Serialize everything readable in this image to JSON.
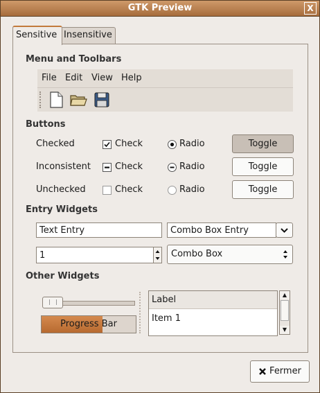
{
  "window": {
    "title": "GTK Preview",
    "close_symbol": "X"
  },
  "tabs": [
    {
      "label": "Sensitive"
    },
    {
      "label": "Insensitive"
    }
  ],
  "sections": {
    "menus": "Menu and Toolbars",
    "buttons": "Buttons",
    "entries": "Entry Widgets",
    "other": "Other Widgets"
  },
  "menu": [
    "File",
    "Edit",
    "View",
    "Help"
  ],
  "toolbar_icons": [
    "new-document-icon",
    "open-folder-icon",
    "save-floppy-icon"
  ],
  "buttons": {
    "rows": [
      {
        "label": "Checked",
        "check": "Check",
        "radio": "Radio",
        "toggle": "Toggle",
        "state": "checked"
      },
      {
        "label": "Inconsistent",
        "check": "Check",
        "radio": "Radio",
        "toggle": "Toggle",
        "state": "inconsistent"
      },
      {
        "label": "Unchecked",
        "check": "Check",
        "radio": "Radio",
        "toggle": "Toggle",
        "state": "unchecked"
      }
    ]
  },
  "entries": {
    "text_entry": "Text Entry",
    "combo_entry": "Combo Box Entry",
    "spin_value": "1",
    "combo_box": "Combo Box"
  },
  "other": {
    "slider_value": 0.0,
    "progress_text": "Progress Bar",
    "progress_fraction": 0.65,
    "tree_header": "Label",
    "tree_items": [
      "Item 1"
    ]
  },
  "footer": {
    "close_label": "Fermer"
  },
  "colors": {
    "accent": "#c27a3b",
    "title_bar": "#b57a47"
  }
}
